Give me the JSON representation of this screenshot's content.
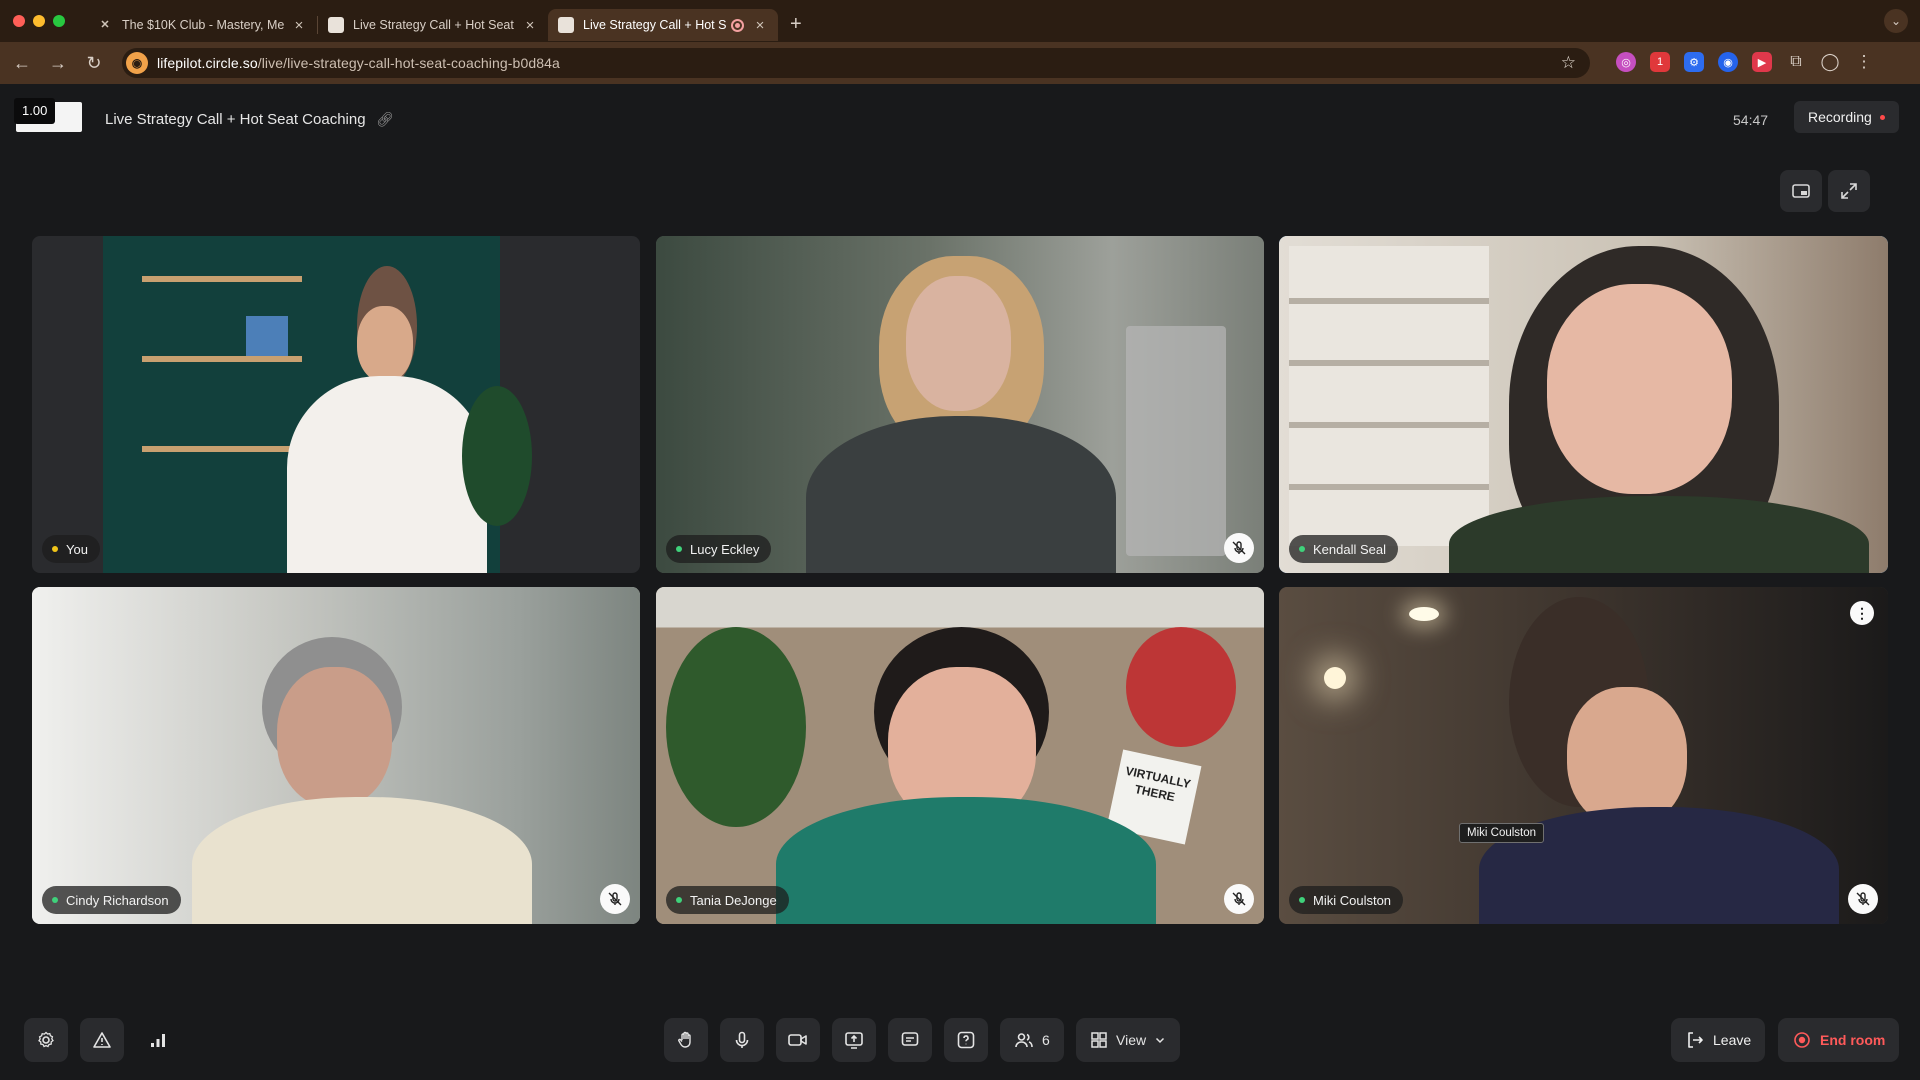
{
  "browser": {
    "tabs": [
      {
        "title": "The $10K Club - Mastery, Me",
        "active": false
      },
      {
        "title": "Live Strategy Call + Hot Seat",
        "active": false
      },
      {
        "title": "Live Strategy Call + Hot S",
        "active": true
      }
    ],
    "new_tab": "+",
    "url_host": "lifepilot.circle.so",
    "url_path": "/live/live-strategy-call-hot-seat-coaching-b0d84a",
    "extension_badge": "1"
  },
  "header": {
    "zoom_level": "1.00",
    "meeting_title": "Live Strategy Call + Hot Seat Coaching",
    "timer": "54:47",
    "recording_label": "Recording"
  },
  "participants": [
    {
      "name": "You",
      "muted": false,
      "self": true
    },
    {
      "name": "Lucy Eckley",
      "muted": true
    },
    {
      "name": "Kendall Seal",
      "muted": false,
      "speaking": true
    },
    {
      "name": "Cindy Richardson",
      "muted": true
    },
    {
      "name": "Tania DeJonge",
      "muted": true
    },
    {
      "name": "Miki Coulston",
      "muted": true,
      "hover_label": "Miki Coulston"
    }
  ],
  "scene_text": {
    "letterboard": "VIRTUALLY THERE"
  },
  "toolbar": {
    "participant_count": "6",
    "view_label": "View",
    "leave_label": "Leave",
    "end_label": "End room"
  },
  "colors": {
    "speaking_outline": "#2d84d8",
    "end_room_red": "#ff5a5a",
    "live_dot": "#3fd27b",
    "tab_bar": "#2b1d12"
  }
}
